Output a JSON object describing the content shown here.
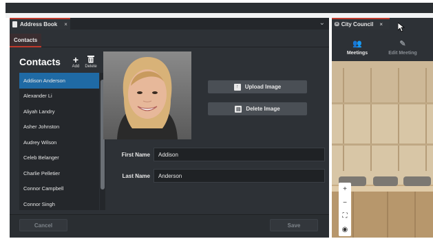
{
  "left_window": {
    "tab_title": "Address Book",
    "tab_close": "×",
    "chevron": "⌄",
    "subtab": "Contacts",
    "contacts_title": "Contacts",
    "add_label": "Add",
    "delete_label": "Delete",
    "contacts": [
      "Addison Anderson",
      "Alexander Li",
      "Aliyah Landry",
      "Asher Johnston",
      "Audrey Wilson",
      "Celeb Belanger",
      "Charlie Pelletier",
      "Connor Campbell",
      "Connor Singh"
    ],
    "selected_index": 0,
    "upload_image_label": "Upload Image",
    "delete_image_label": "Delete Image",
    "first_name_label": "First Name",
    "first_name_value": "Addison",
    "last_name_label": "Last Name",
    "last_name_value": "Anderson",
    "cancel_label": "Cancel",
    "save_label": "Save"
  },
  "right_window": {
    "tab_title": "City Council",
    "tab_close": "×",
    "meetings_label": "Meetings",
    "edit_meeting_label": "Edit Meeting"
  },
  "map_controls": {
    "zoom_in": "+",
    "zoom_out": "−",
    "fullscreen": "⛶",
    "visibility": "◉"
  },
  "colors": {
    "accent_red": "#c0392b",
    "selected_blue": "#1f6aa5",
    "panel_bg": "#2d3136"
  }
}
